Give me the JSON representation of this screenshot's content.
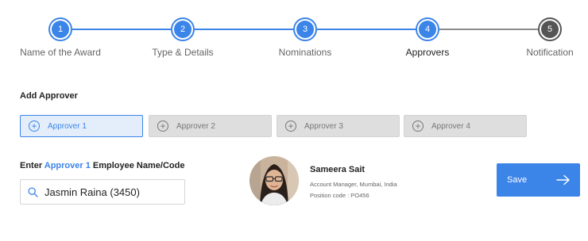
{
  "stepper": {
    "steps": [
      {
        "number": "1",
        "label": "Name of the Award",
        "state": "complete"
      },
      {
        "number": "2",
        "label": "Type & Details",
        "state": "complete"
      },
      {
        "number": "3",
        "label": "Nominations",
        "state": "complete"
      },
      {
        "number": "4",
        "label": "Approvers",
        "state": "current"
      },
      {
        "number": "5",
        "label": "Notification",
        "state": "pending"
      }
    ]
  },
  "add_approver": {
    "title": "Add Approver",
    "tabs": [
      {
        "label": "Approver 1",
        "selected": true
      },
      {
        "label": "Approver 2",
        "selected": false
      },
      {
        "label": "Approver 3",
        "selected": false
      },
      {
        "label": "Approver 4",
        "selected": false
      }
    ]
  },
  "employee_search": {
    "label_prefix": "Enter ",
    "label_highlight": "Approver 1",
    "label_suffix": " Employee Name/Code",
    "value": "Jasmin Raina (3450)",
    "icon": "search-icon"
  },
  "profile": {
    "name": "Sameera Sait",
    "role": "Account Manager, Mumbai, India",
    "position_code": "Position code : PO456"
  },
  "save": {
    "label": "Save",
    "icon": "arrow-right-icon"
  },
  "colors": {
    "accent": "#3b84e8",
    "pending": "#555555",
    "tab_selected_bg": "#e4eefb",
    "tab_unselected_bg": "#dedede"
  }
}
